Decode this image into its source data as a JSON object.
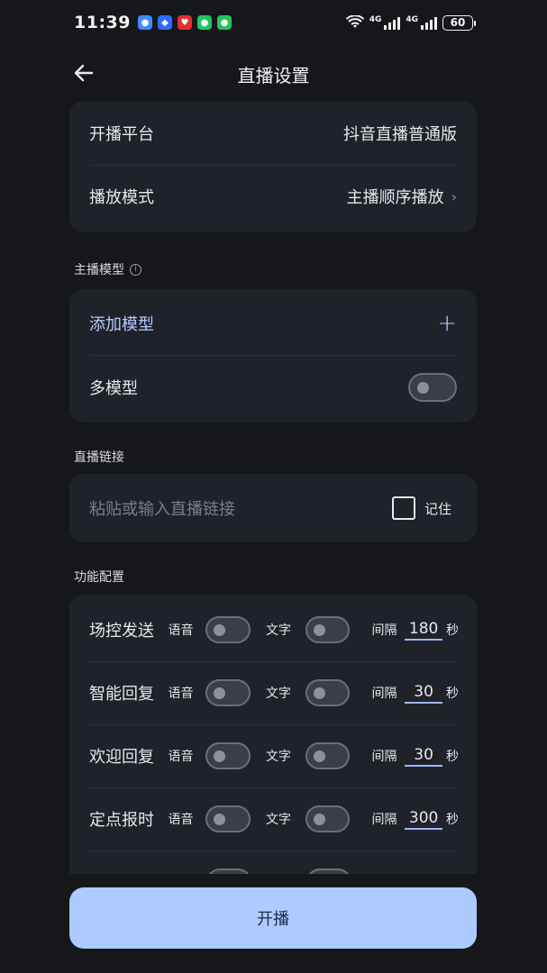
{
  "status": {
    "time": "11:39",
    "network_1": "4G",
    "network_2": "4G",
    "battery": "60"
  },
  "header": {
    "title": "直播设置"
  },
  "platform_card": {
    "platform_label": "开播平台",
    "platform_value": "抖音直播普通版",
    "mode_label": "播放模式",
    "mode_value": "主播顺序播放"
  },
  "model_section": {
    "title": "主播模型",
    "add_label": "添加模型",
    "add_icon": "+",
    "multi_label": "多模型"
  },
  "link_section": {
    "title": "直播链接",
    "placeholder": "粘贴或输入直播链接",
    "remember_label": "记住"
  },
  "func_section": {
    "title": "功能配置",
    "voice_label": "语音",
    "text_label": "文字",
    "interval_label": "间隔",
    "unit": "秒",
    "rows": [
      {
        "name": "场控发送",
        "interval": "180"
      },
      {
        "name": "智能回复",
        "interval": "30"
      },
      {
        "name": "欢迎回复",
        "interval": "30"
      },
      {
        "name": "定点报时",
        "interval": "300"
      }
    ]
  },
  "footer": {
    "start_label": "开播"
  },
  "colors": {
    "background": "#16171b",
    "card": "#1f2229",
    "accent": "#b7ccff",
    "button": "#aecbff"
  }
}
